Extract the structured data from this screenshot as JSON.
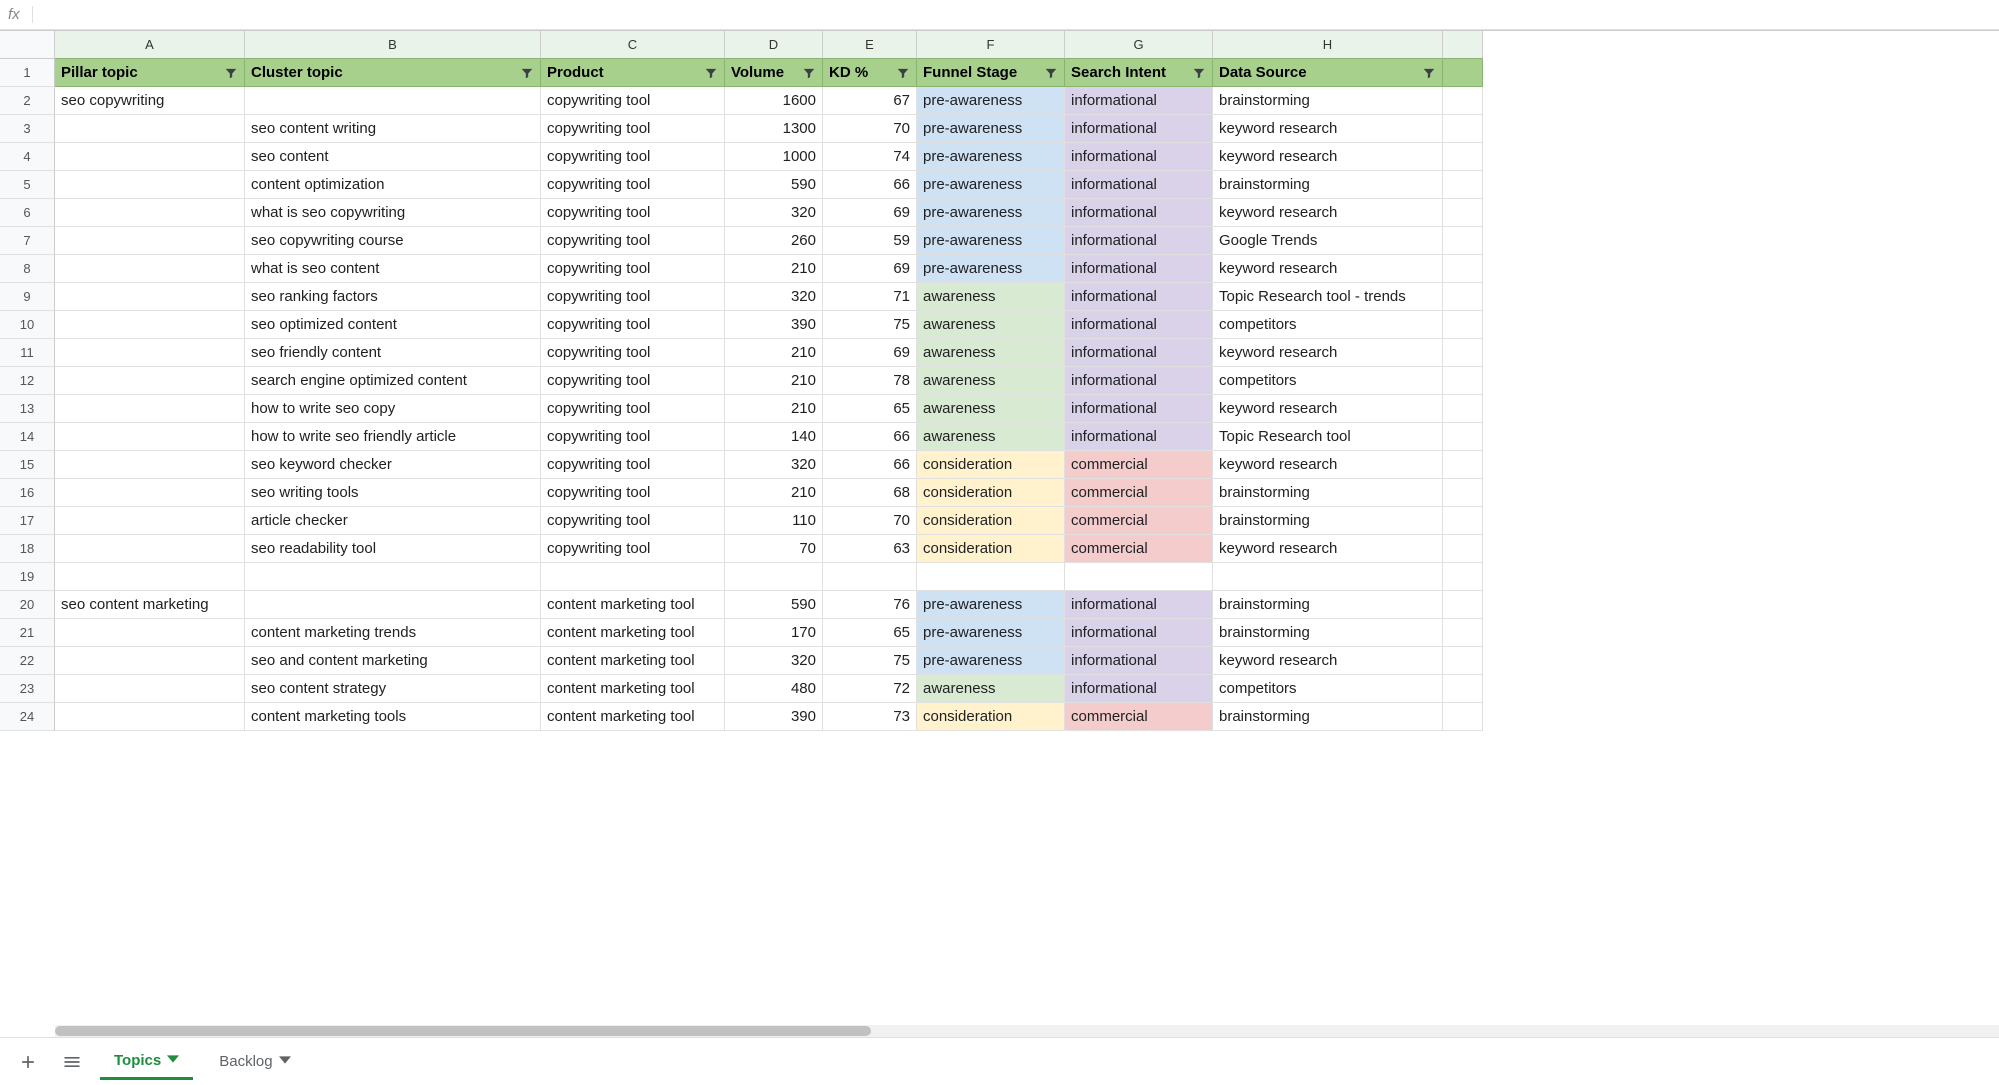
{
  "formula_bar": {
    "fx_label": "fx",
    "value": ""
  },
  "columns": [
    "A",
    "B",
    "C",
    "D",
    "E",
    "F",
    "G",
    "H"
  ],
  "headers": {
    "A": "Pillar topic",
    "B": "Cluster topic",
    "C": "Product",
    "D": "Volume",
    "E": "KD %",
    "F": "Funnel Stage",
    "G": "Search Intent",
    "H": "Data Source"
  },
  "rows": [
    {
      "n": 2,
      "A": "seo copywriting",
      "B": "",
      "C": "copywriting tool",
      "D": "1600",
      "E": "67",
      "F": "pre-awareness",
      "G": "informational",
      "H": "brainstorming"
    },
    {
      "n": 3,
      "A": "",
      "B": "seo content writing",
      "C": "copywriting tool",
      "D": "1300",
      "E": "70",
      "F": "pre-awareness",
      "G": "informational",
      "H": "keyword research"
    },
    {
      "n": 4,
      "A": "",
      "B": "seo content",
      "C": "copywriting tool",
      "D": "1000",
      "E": "74",
      "F": "pre-awareness",
      "G": "informational",
      "H": "keyword research"
    },
    {
      "n": 5,
      "A": "",
      "B": "content optimization",
      "C": "copywriting tool",
      "D": "590",
      "E": "66",
      "F": "pre-awareness",
      "G": "informational",
      "H": "brainstorming"
    },
    {
      "n": 6,
      "A": "",
      "B": "what is seo copywriting",
      "C": "copywriting tool",
      "D": "320",
      "E": "69",
      "F": "pre-awareness",
      "G": "informational",
      "H": "keyword research"
    },
    {
      "n": 7,
      "A": "",
      "B": "seo copywriting course",
      "C": "copywriting tool",
      "D": "260",
      "E": "59",
      "F": "pre-awareness",
      "G": "informational",
      "H": "Google Trends"
    },
    {
      "n": 8,
      "A": "",
      "B": "what is seo content",
      "C": "copywriting tool",
      "D": "210",
      "E": "69",
      "F": "pre-awareness",
      "G": "informational",
      "H": "keyword research"
    },
    {
      "n": 9,
      "A": "",
      "B": "seo ranking factors",
      "C": "copywriting tool",
      "D": "320",
      "E": "71",
      "F": "awareness",
      "G": "informational",
      "H": "Topic Research tool - trends"
    },
    {
      "n": 10,
      "A": "",
      "B": "seo optimized content",
      "C": "copywriting tool",
      "D": "390",
      "E": "75",
      "F": "awareness",
      "G": "informational",
      "H": "competitors"
    },
    {
      "n": 11,
      "A": "",
      "B": "seo friendly content",
      "C": "copywriting tool",
      "D": "210",
      "E": "69",
      "F": "awareness",
      "G": "informational",
      "H": "keyword research"
    },
    {
      "n": 12,
      "A": "",
      "B": "search engine optimized content",
      "C": "copywriting tool",
      "D": "210",
      "E": "78",
      "F": "awareness",
      "G": "informational",
      "H": "competitors"
    },
    {
      "n": 13,
      "A": "",
      "B": "how to write seo copy",
      "C": "copywriting tool",
      "D": "210",
      "E": "65",
      "F": "awareness",
      "G": "informational",
      "H": "keyword research"
    },
    {
      "n": 14,
      "A": "",
      "B": "how to write seo friendly article",
      "C": "copywriting tool",
      "D": "140",
      "E": "66",
      "F": "awareness",
      "G": "informational",
      "H": "Topic Research tool"
    },
    {
      "n": 15,
      "A": "",
      "B": "seo keyword checker",
      "C": "copywriting tool",
      "D": "320",
      "E": "66",
      "F": "consideration",
      "G": "commercial",
      "H": "keyword research"
    },
    {
      "n": 16,
      "A": "",
      "B": "seo writing tools",
      "C": "copywriting tool",
      "D": "210",
      "E": "68",
      "F": "consideration",
      "G": "commercial",
      "H": "brainstorming"
    },
    {
      "n": 17,
      "A": "",
      "B": "article checker",
      "C": "copywriting tool",
      "D": "110",
      "E": "70",
      "F": "consideration",
      "G": "commercial",
      "H": "brainstorming"
    },
    {
      "n": 18,
      "A": "",
      "B": "seo readability tool",
      "C": "copywriting tool",
      "D": "70",
      "E": "63",
      "F": "consideration",
      "G": "commercial",
      "H": "keyword research"
    },
    {
      "n": 19,
      "A": "",
      "B": "",
      "C": "",
      "D": "",
      "E": "",
      "F": "",
      "G": "",
      "H": ""
    },
    {
      "n": 20,
      "A": "seo content marketing",
      "B": "",
      "C": "content marketing tool",
      "D": "590",
      "E": "76",
      "F": "pre-awareness",
      "G": "informational",
      "H": "brainstorming"
    },
    {
      "n": 21,
      "A": "",
      "B": "content marketing trends",
      "C": "content marketing tool",
      "D": "170",
      "E": "65",
      "F": "pre-awareness",
      "G": "informational",
      "H": "brainstorming"
    },
    {
      "n": 22,
      "A": "",
      "B": "seo and content marketing",
      "C": "content marketing tool",
      "D": "320",
      "E": "75",
      "F": "pre-awareness",
      "G": "informational",
      "H": "keyword research"
    },
    {
      "n": 23,
      "A": "",
      "B": "seo content strategy",
      "C": "content marketing tool",
      "D": "480",
      "E": "72",
      "F": "awareness",
      "G": "informational",
      "H": "competitors"
    },
    {
      "n": 24,
      "A": "",
      "B": "content marketing tools",
      "C": "content marketing tool",
      "D": "390",
      "E": "73",
      "F": "consideration",
      "G": "commercial",
      "H": "brainstorming"
    }
  ],
  "funnel_colors": {
    "pre-awareness": "bg-preaware",
    "awareness": "bg-aware",
    "consideration": "bg-consider"
  },
  "intent_colors": {
    "informational": "bg-info",
    "commercial": "bg-commercial"
  },
  "tabs": {
    "add_label": "+",
    "menu_label": "≡",
    "active": "Topics",
    "inactive": "Backlog"
  }
}
